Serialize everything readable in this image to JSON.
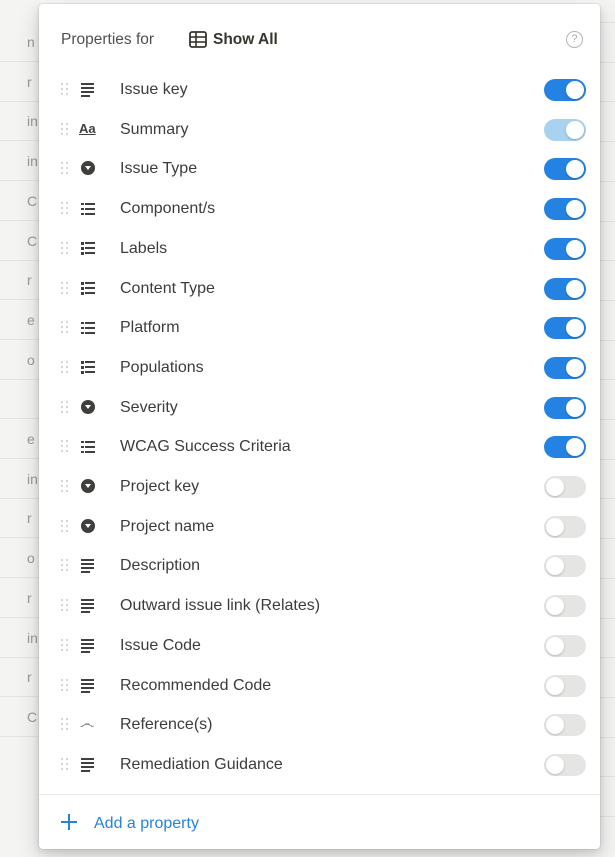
{
  "background": {
    "left_fragments": [
      "n",
      "r",
      "in",
      "in",
      "C",
      "C",
      "r",
      "e",
      "o",
      "",
      "e",
      "in",
      "r",
      "o",
      "r",
      "in",
      "r",
      "C"
    ]
  },
  "popup": {
    "header": {
      "prefix": "Properties for",
      "view_icon": "table-icon",
      "view_name": "Show All",
      "help_icon": "help-circle-icon",
      "help_glyph": "?"
    },
    "properties": [
      {
        "label": "Issue key",
        "icon": "text-lines-icon",
        "state": "on"
      },
      {
        "label": "Summary",
        "icon": "title-aa-icon",
        "icon_text": "Aa",
        "state": "disabled-on"
      },
      {
        "label": "Issue Type",
        "icon": "select-icon",
        "state": "on"
      },
      {
        "label": "Component/s",
        "icon": "multi-select-icon",
        "state": "on"
      },
      {
        "label": "Labels",
        "icon": "multi-select-icon",
        "state": "on"
      },
      {
        "label": "Content Type",
        "icon": "multi-select-icon",
        "state": "on"
      },
      {
        "label": "Platform",
        "icon": "multi-select-icon",
        "state": "on"
      },
      {
        "label": "Populations",
        "icon": "multi-select-icon",
        "state": "on"
      },
      {
        "label": "Severity",
        "icon": "select-icon",
        "state": "on"
      },
      {
        "label": "WCAG Success Criteria",
        "icon": "multi-select-icon",
        "state": "on"
      },
      {
        "label": "Project key",
        "icon": "select-icon",
        "state": "off"
      },
      {
        "label": "Project name",
        "icon": "select-icon",
        "state": "off"
      },
      {
        "label": "Description",
        "icon": "text-lines-icon",
        "state": "off"
      },
      {
        "label": "Outward issue link (Relates)",
        "icon": "text-lines-icon",
        "state": "off"
      },
      {
        "label": "Issue Code",
        "icon": "text-lines-icon",
        "state": "off"
      },
      {
        "label": "Recommended Code",
        "icon": "text-lines-icon",
        "state": "off"
      },
      {
        "label": "Reference(s)",
        "icon": "relation-icon",
        "icon_text": "෴",
        "state": "off"
      },
      {
        "label": "Remediation Guidance",
        "icon": "text-lines-icon",
        "state": "off"
      }
    ],
    "add_property": {
      "icon": "plus-icon",
      "label": "Add a property"
    }
  },
  "colors": {
    "toggle_on": "#2483e2",
    "toggle_disabled_on": "#a9d2f1",
    "toggle_off": "#e5e5e4",
    "accent": "#2483e2"
  }
}
